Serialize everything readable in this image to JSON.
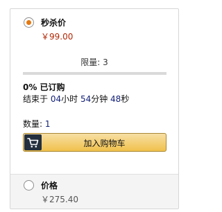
{
  "offers": {
    "deal": {
      "title": "秒杀价",
      "price": "￥99.00",
      "selected": true,
      "limit": "限量: 3",
      "claimed_text": "0% 已订购",
      "claimed_fraction": 0,
      "ends": {
        "prefix": "结束于 ",
        "hours": "04",
        "hours_unit": "小时 ",
        "minutes": "54",
        "minutes_unit": "分钟 ",
        "seconds": "48",
        "seconds_unit": "秒"
      },
      "quantity_label": "数量: ",
      "quantity_value": "1",
      "add_to_cart": "加入购物车"
    },
    "regular": {
      "title": "价格",
      "price": "￥275.40",
      "selected": false
    }
  },
  "colors": {
    "accent": "#e47911",
    "deal_price": "#b12704",
    "number_blue": "#0f1d74",
    "button_top": "#f7dfa5",
    "button_bottom": "#f0c14b",
    "cart_icon_bg": "#232f3e"
  },
  "icons": {
    "cart": "shopping-cart-icon"
  }
}
